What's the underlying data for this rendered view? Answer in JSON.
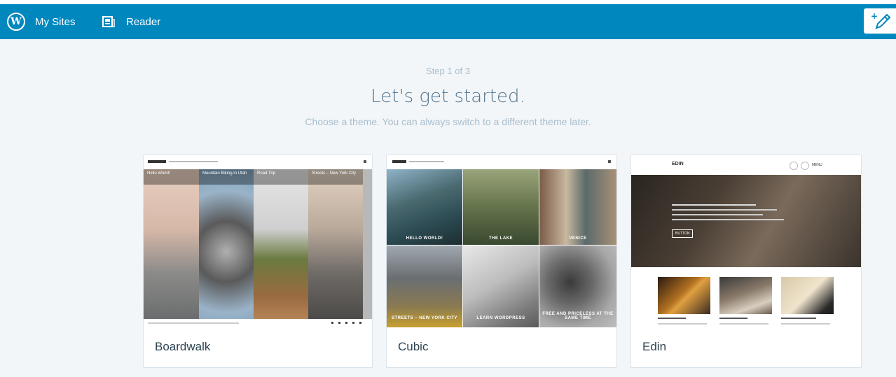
{
  "masterbar": {
    "my_sites": "My Sites",
    "reader": "Reader",
    "color": "#0087be"
  },
  "signup": {
    "step": "Step 1 of 3",
    "title": "Let's get started.",
    "subtitle": "Choose a theme. You can always switch to a different theme later."
  },
  "themes": [
    {
      "name": "Boardwalk",
      "preview": {
        "posts": [
          "Hello World!",
          "Mountain Biking in Utah",
          "Road Trip",
          "Streets – New York City"
        ]
      }
    },
    {
      "name": "Cubic",
      "preview": {
        "posts": [
          "HELLO WORLD!",
          "THE LAKE",
          "VENICE",
          "STREETS – NEW YORK CITY",
          "LEARN WORDPRESS",
          "FREE AND PRICELESS AT THE SAME TIME"
        ]
      }
    },
    {
      "name": "Edin",
      "preview": {
        "site_title": "EDIN",
        "menu": "MENU",
        "button": "BUTTON"
      }
    }
  ]
}
